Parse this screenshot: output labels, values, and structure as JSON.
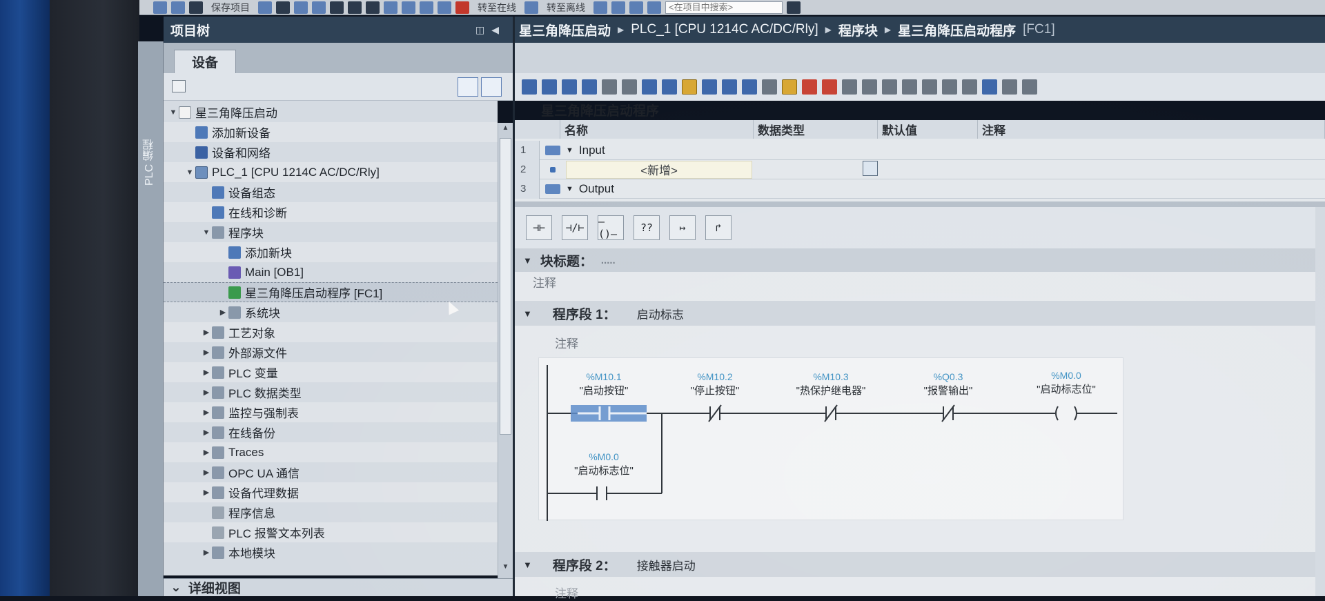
{
  "toolbar": {
    "save_project_label": "保存项目",
    "go_online_label": "转至在线",
    "go_offline_label": "转至离线",
    "search_placeholder": "<在项目中搜索>"
  },
  "side_tab": {
    "label": "PLC 编程"
  },
  "project_tree": {
    "title": "项目树",
    "devices_tab": "设备",
    "items": [
      {
        "label": "星三角降压启动",
        "indent": 0,
        "twisty": "▼",
        "icon": "project-icon"
      },
      {
        "label": "添加新设备",
        "indent": 1,
        "twisty": "",
        "icon": "add-device-icon"
      },
      {
        "label": "设备和网络",
        "indent": 1,
        "twisty": "",
        "icon": "network-icon"
      },
      {
        "label": "PLC_1 [CPU 1214C AC/DC/Rly]",
        "indent": 1,
        "twisty": "▼",
        "icon": "cpu-icon"
      },
      {
        "label": "设备组态",
        "indent": 2,
        "twisty": "",
        "icon": "device-config-icon"
      },
      {
        "label": "在线和诊断",
        "indent": 2,
        "twisty": "",
        "icon": "diagnostics-icon"
      },
      {
        "label": "程序块",
        "indent": 2,
        "twisty": "▼",
        "icon": "folder-icon"
      },
      {
        "label": "添加新块",
        "indent": 3,
        "twisty": "",
        "icon": "add-block-icon"
      },
      {
        "label": "Main [OB1]",
        "indent": 3,
        "twisty": "",
        "icon": "ob-icon"
      },
      {
        "label": "星三角降压启动程序 [FC1]",
        "indent": 3,
        "twisty": "",
        "icon": "fc-icon",
        "selected": true
      },
      {
        "label": "系统块",
        "indent": 3,
        "twisty": "▶",
        "icon": "folder-icon"
      },
      {
        "label": "工艺对象",
        "indent": 2,
        "twisty": "▶",
        "icon": "folder-icon"
      },
      {
        "label": "外部源文件",
        "indent": 2,
        "twisty": "▶",
        "icon": "folder-icon"
      },
      {
        "label": "PLC 变量",
        "indent": 2,
        "twisty": "▶",
        "icon": "folder-icon"
      },
      {
        "label": "PLC 数据类型",
        "indent": 2,
        "twisty": "▶",
        "icon": "folder-icon"
      },
      {
        "label": "监控与强制表",
        "indent": 2,
        "twisty": "▶",
        "icon": "folder-icon"
      },
      {
        "label": "在线备份",
        "indent": 2,
        "twisty": "▶",
        "icon": "folder-icon"
      },
      {
        "label": "Traces",
        "indent": 2,
        "twisty": "▶",
        "icon": "folder-icon"
      },
      {
        "label": "OPC UA 通信",
        "indent": 2,
        "twisty": "▶",
        "icon": "folder-icon"
      },
      {
        "label": "设备代理数据",
        "indent": 2,
        "twisty": "▶",
        "icon": "folder-icon"
      },
      {
        "label": "程序信息",
        "indent": 2,
        "twisty": "",
        "icon": "info-icon"
      },
      {
        "label": "PLC 报警文本列表",
        "indent": 2,
        "twisty": "",
        "icon": "alarm-text-icon"
      },
      {
        "label": "本地模块",
        "indent": 2,
        "twisty": "▶",
        "icon": "folder-icon"
      }
    ],
    "detail_view_label": "详细视图"
  },
  "breadcrumb": [
    "星三角降压启动",
    "PLC_1 [CPU 1214C AC/DC/Rly]",
    "程序块",
    "星三角降压启动程序"
  ],
  "breadcrumb_suffix": "[FC1]",
  "block": {
    "title": "星三角降压启动程序",
    "interface_columns": [
      "名称",
      "数据类型",
      "默认值",
      "注释"
    ],
    "interface_rows": [
      {
        "num": "1",
        "name": "Input"
      },
      {
        "num": "2",
        "name": "<新增>"
      },
      {
        "num": "3",
        "name": "Output"
      }
    ]
  },
  "favorites": [
    "⊣⊢",
    "⊣/⊢",
    "–()–",
    "??",
    "↦",
    "↱"
  ],
  "block_title_label": "块标题：",
  "block_comment": "注释",
  "networks": [
    {
      "label": "程序段 1：",
      "title": "启动标志",
      "comment": "注释",
      "contacts": [
        {
          "address": "%M10.1",
          "tag": "\"启动按钮\"",
          "type": "NO"
        },
        {
          "address": "%M10.2",
          "tag": "\"停止按钮\"",
          "type": "NC"
        },
        {
          "address": "%M10.3",
          "tag": "\"热保护继电器\"",
          "type": "NC"
        },
        {
          "address": "%Q0.3",
          "tag": "\"报警输出\"",
          "type": "NC"
        }
      ],
      "coil": {
        "address": "%M0.0",
        "tag": "\"启动标志位\""
      },
      "parallel": {
        "address": "%M0.0",
        "tag": "\"启动标志位\""
      }
    },
    {
      "label": "程序段 2：",
      "title": "接触器启动",
      "comment": "注释"
    }
  ],
  "colors": {
    "header_bg": "#2f4256",
    "selected_contact": "#5b8ac9",
    "address_color": "#3b8fc2"
  }
}
